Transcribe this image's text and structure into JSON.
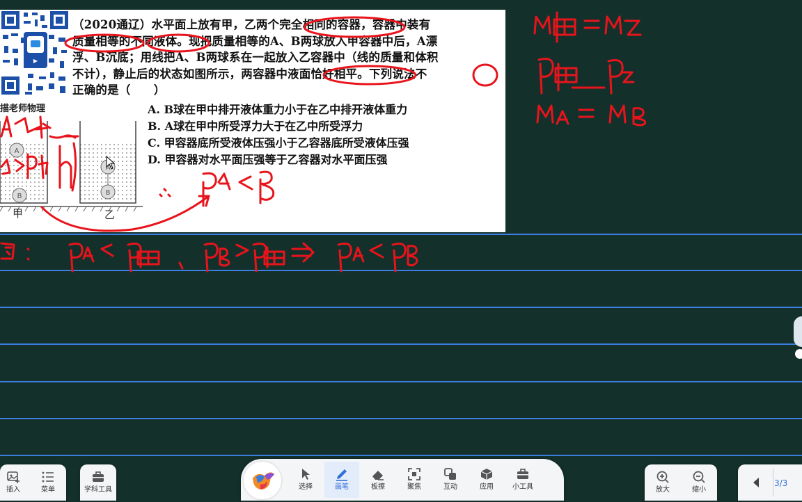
{
  "question": {
    "lines": [
      "（2020通辽）水平面上放有甲，乙两个完全相同的容器，容器中装有",
      "质量相等的不同液体。现把质量相等的A、B两球放入甲容器中后，A漂",
      "浮、B沉底；用线把A、B两球系在一起放入乙容器中（线的质量和体积",
      "不计），静止后的状态如图所示，两容器中液面恰好相平。下列说法不",
      "正确的是（　　）"
    ],
    "options": [
      "A.  B球在甲中排开液体重力小于在乙中排开液体重力",
      "B.  A球在甲中所受浮力大于在乙中所受浮力",
      "C. 甲容器底所受液体压强小于乙容器底所受液体压强",
      "D. 甲容器对水平面压强等于乙容器对水平面压强"
    ],
    "watermark": "描老师物理",
    "figure": {
      "container_left_label": "甲",
      "container_right_label": "乙",
      "ball_a": "A",
      "ball_b": "B"
    }
  },
  "toolbar": {
    "left": [
      {
        "label": "插入",
        "icon": "insert-image-icon"
      },
      {
        "label": "菜单",
        "icon": "menu-icon"
      }
    ],
    "subject_tools": {
      "label": "学科工具",
      "icon": "toolbox-icon"
    },
    "main": [
      {
        "label": "选择",
        "icon": "cursor-icon"
      },
      {
        "label": "画笔",
        "icon": "pen-icon",
        "active": true
      },
      {
        "label": "板擦",
        "icon": "eraser-icon"
      },
      {
        "label": "聚焦",
        "icon": "focus-icon"
      },
      {
        "label": "互动",
        "icon": "interact-icon"
      },
      {
        "label": "应用",
        "icon": "cube-icon"
      },
      {
        "label": "小工具",
        "icon": "toolbox-icon"
      }
    ],
    "zoom": [
      {
        "label": "放大",
        "icon": "zoom-in-icon"
      },
      {
        "label": "缩小",
        "icon": "zoom-out-icon"
      }
    ],
    "page_indicator": "3/3"
  },
  "colors": {
    "board_bg": "#14302b",
    "ruled_line": "#3d7fe0",
    "ink": "#e8141c",
    "active_tool": "#2f6fd8"
  }
}
